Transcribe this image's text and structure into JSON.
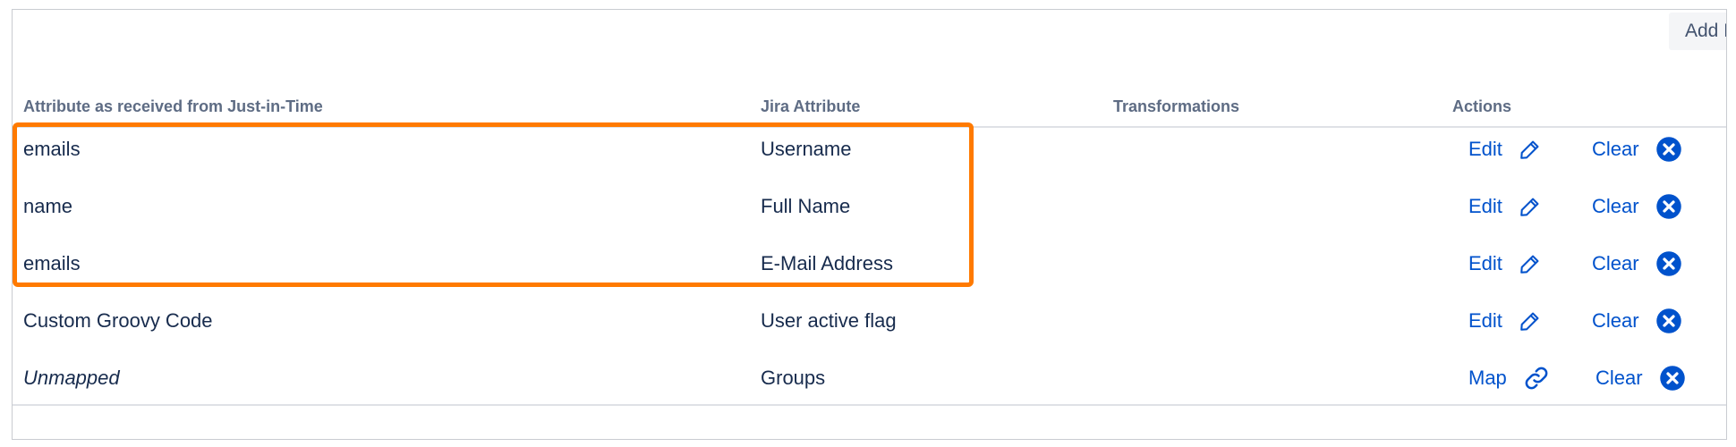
{
  "toolbar": {
    "add_label": "Add Mapping"
  },
  "table": {
    "headers": {
      "source": "Attribute as received from Just-in-Time",
      "jira": "Jira Attribute",
      "transformations": "Transformations",
      "actions": "Actions"
    },
    "rows": [
      {
        "source": "emails",
        "jira": "Username",
        "transformations": "",
        "primary_action": "Edit",
        "primary_icon": "pencil-icon",
        "clear_label": "Clear",
        "clear_icon": "close-circle-icon"
      },
      {
        "source": "name",
        "jira": "Full Name",
        "transformations": "",
        "primary_action": "Edit",
        "primary_icon": "pencil-icon",
        "clear_label": "Clear",
        "clear_icon": "close-circle-icon"
      },
      {
        "source": "emails",
        "jira": "E-Mail Address",
        "transformations": "",
        "primary_action": "Edit",
        "primary_icon": "pencil-icon",
        "clear_label": "Clear",
        "clear_icon": "close-circle-icon"
      },
      {
        "source": "Custom Groovy Code",
        "jira": "User active flag",
        "transformations": "",
        "primary_action": "Edit",
        "primary_icon": "pencil-icon",
        "clear_label": "Clear",
        "clear_icon": "close-circle-icon"
      },
      {
        "source": "Unmapped",
        "jira": "Groups",
        "transformations": "",
        "primary_action": "Map",
        "primary_icon": "link-icon",
        "clear_label": "Clear",
        "clear_icon": "close-circle-icon"
      }
    ]
  },
  "colors": {
    "link": "#0052cc",
    "highlight": "#ff7a00",
    "text": "#172b4d",
    "header_text": "#5e6c84"
  }
}
